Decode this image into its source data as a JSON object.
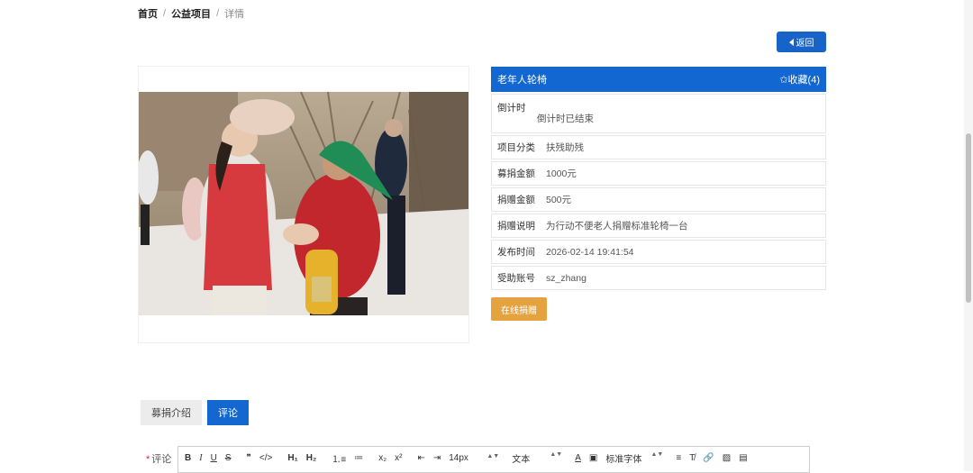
{
  "breadcrumb": {
    "home": "首页",
    "section": "公益项目",
    "current": "详情",
    "sep": "/"
  },
  "back_button": {
    "label": "返回"
  },
  "project": {
    "title": "老年人轮椅",
    "favorite_label": "✩收藏(4)",
    "fields": {
      "countdown": {
        "key": "倒计时",
        "value": "倒计时已结束"
      },
      "category": {
        "key": "项目分类",
        "value": "扶残助残"
      },
      "raise_amount": {
        "key": "募捐金额",
        "value": "1000元"
      },
      "donated_amount": {
        "key": "捐赠金额",
        "value": "500元"
      },
      "description": {
        "key": "捐赠说明",
        "value": "为行动不便老人捐赠标准轮椅一台"
      },
      "publish_time": {
        "key": "发布时间",
        "value": "2026-02-14 19:41:54"
      },
      "beneficiary": {
        "key": "受助账号",
        "value": "sz_zhang"
      }
    }
  },
  "donate_button": {
    "label": "在线捐赠"
  },
  "tabs": [
    {
      "label": "募捐介绍"
    },
    {
      "label": "评论"
    }
  ],
  "comment": {
    "label": "评论",
    "required_mark": "*",
    "toolbar": {
      "bold": "B",
      "italic": "I",
      "underline": "U",
      "strike": "S",
      "quote": "❞",
      "code": "</>",
      "h1": "H₁",
      "h2": "H₂",
      "ordered_list": "⒈≡",
      "bullet_list": "≔",
      "subscript": "x₂",
      "superscript": "x²",
      "outdent": "⇤",
      "indent": "⇥",
      "font_size": "14px",
      "text_style": "文本",
      "font_color": "A",
      "bg_color": "▣",
      "font_family": "标准字体",
      "align": "≡",
      "clear_format": "T̸",
      "link": "🔗",
      "image": "▨",
      "video": "▤"
    }
  },
  "colors": {
    "primary": "#1367d1",
    "donate": "#e5a33f"
  }
}
